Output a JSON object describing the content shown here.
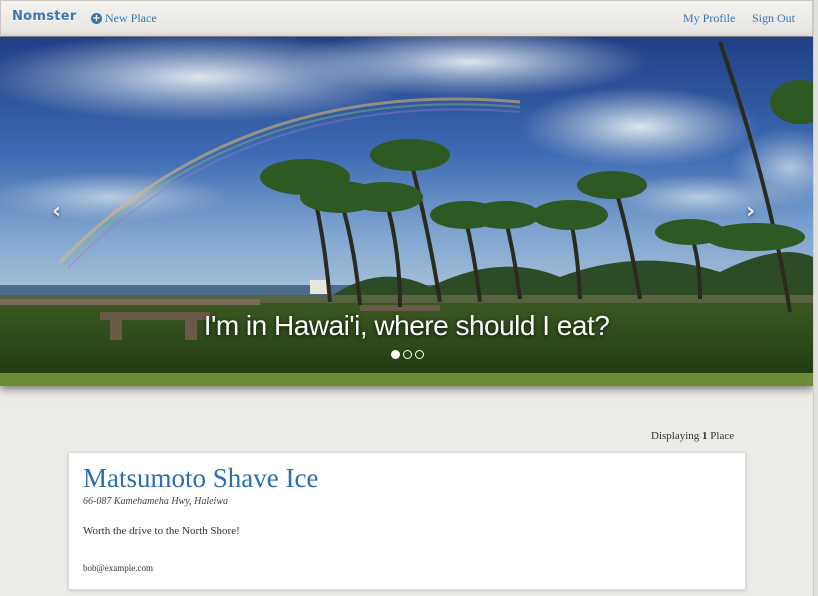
{
  "navbar": {
    "brand": "Nomster",
    "new_place": "New Place",
    "my_profile": "My Profile",
    "sign_out": "Sign Out"
  },
  "hero": {
    "caption": "I'm in Hawai'i, where should I eat?",
    "slide_count": 3,
    "active_slide": 1
  },
  "listing": {
    "count_prefix": "Displaying",
    "count": "1",
    "count_suffix": "Place"
  },
  "places": [
    {
      "name": "Matsumoto Shave Ice",
      "address": "66-087 Kamehameha Hwy, Haleiwa",
      "description": "Worth the drive to the North Shore!",
      "email": "bob@example.com"
    }
  ],
  "colors": {
    "link": "#3a76b0",
    "heading": "#2b6fb0",
    "background": "#ecebe8"
  }
}
